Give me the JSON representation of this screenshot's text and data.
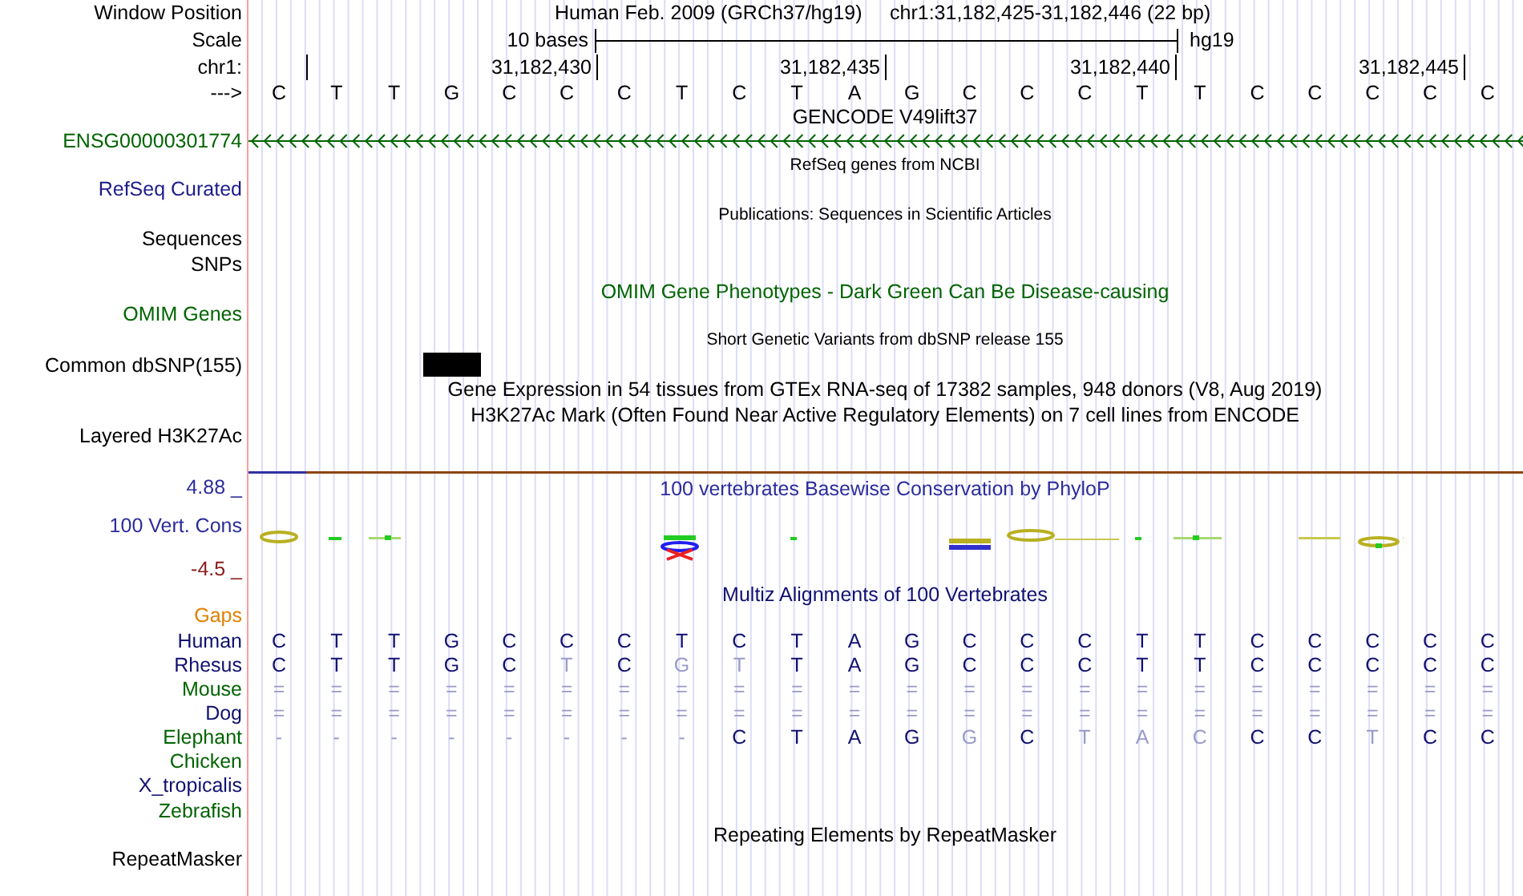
{
  "labels": [
    {
      "text": "Window Position",
      "color": "#000000"
    },
    {
      "text": "Scale",
      "color": "#000000"
    },
    {
      "text": "chr1:",
      "color": "#000000"
    },
    {
      "text": "--->",
      "color": "#000000"
    },
    {
      "text": "ENSG00000301774",
      "color": "#006400"
    },
    {
      "text": "RefSeq Curated",
      "color": "#1c1c8c"
    },
    {
      "text": "Sequences",
      "color": "#000000"
    },
    {
      "text": "SNPs",
      "color": "#000000"
    },
    {
      "text": "OMIM Genes",
      "color": "#006400"
    },
    {
      "text": "Common dbSNP(155)",
      "color": "#000000"
    },
    {
      "text": "Layered H3K27Ac",
      "color": "#000000"
    },
    {
      "text": "4.88 _",
      "color": "#2c2c9c"
    },
    {
      "text": "100 Vert. Cons",
      "color": "#2c2c9c"
    },
    {
      "text": "-4.5 _",
      "color": "#8b1a1a"
    },
    {
      "text": "Gaps",
      "color": "#e08000"
    },
    {
      "text": "Human",
      "color": "#101070"
    },
    {
      "text": "Rhesus",
      "color": "#101070"
    },
    {
      "text": "Mouse",
      "color": "#006400"
    },
    {
      "text": "Dog",
      "color": "#101070"
    },
    {
      "text": "Elephant",
      "color": "#006400"
    },
    {
      "text": "Chicken",
      "color": "#006400"
    },
    {
      "text": "X_tropicalis",
      "color": "#101070"
    },
    {
      "text": "Zebrafish",
      "color": "#006400"
    },
    {
      "text": "RepeatMasker",
      "color": "#000000"
    }
  ],
  "position": {
    "assembly": "Human Feb. 2009 (GRCh37/hg19)",
    "range": "chr1:31,182,425-31,182,446 (22 bp)"
  },
  "scale": {
    "length": "10 bases",
    "db": "hg19"
  },
  "ruler_ticks": [
    "31,182,430",
    "31,182,435",
    "31,182,440",
    "31,182,445"
  ],
  "sequence": [
    "C",
    "T",
    "T",
    "G",
    "C",
    "C",
    "C",
    "T",
    "C",
    "T",
    "A",
    "G",
    "C",
    "C",
    "C",
    "T",
    "T",
    "C",
    "C",
    "C",
    "C",
    "C"
  ],
  "tracks": [
    {
      "text": "GENCODE V49lift37",
      "kind": "normal",
      "color": "#000000"
    },
    {
      "text": "RefSeq genes from NCBI",
      "kind": "small",
      "color": "#000000"
    },
    {
      "text": "Publications: Sequences in Scientific Articles",
      "kind": "small",
      "color": "#000000"
    },
    {
      "text": "OMIM Gene Phenotypes - Dark Green Can Be Disease-causing",
      "kind": "normal",
      "color": "#006400"
    },
    {
      "text": "Short Genetic Variants from dbSNP release 155",
      "kind": "small",
      "color": "#000000"
    },
    {
      "text": "Gene Expression in 54 tissues from GTEx RNA-seq of 17382 samples, 948 donors (V8, Aug 2019)",
      "kind": "normal",
      "color": "#000000"
    },
    {
      "text": "H3K27Ac Mark (Often Found Near Active Regulatory Elements) on 7 cell lines from ENCODE",
      "kind": "normal",
      "color": "#000000"
    },
    {
      "text": "100 vertebrates Basewise Conservation by PhyloP",
      "kind": "normal",
      "color": "#2c2c9c"
    },
    {
      "text": "Multiz Alignments of 100 Vertebrates",
      "kind": "normal",
      "color": "#101070"
    },
    {
      "text": "Repeating Elements by RepeatMasker",
      "kind": "normal",
      "color": "#000000"
    }
  ],
  "alignment": [
    {
      "bases": [
        {
          "b": "C",
          "faded": false
        },
        {
          "b": "T",
          "faded": false
        },
        {
          "b": "T",
          "faded": false
        },
        {
          "b": "G",
          "faded": false
        },
        {
          "b": "C",
          "faded": false
        },
        {
          "b": "C",
          "faded": false
        },
        {
          "b": "C",
          "faded": false
        },
        {
          "b": "T",
          "faded": false
        },
        {
          "b": "C",
          "faded": false
        },
        {
          "b": "T",
          "faded": false
        },
        {
          "b": "A",
          "faded": false
        },
        {
          "b": "G",
          "faded": false
        },
        {
          "b": "C",
          "faded": false
        },
        {
          "b": "C",
          "faded": false
        },
        {
          "b": "C",
          "faded": false
        },
        {
          "b": "T",
          "faded": false
        },
        {
          "b": "T",
          "faded": false
        },
        {
          "b": "C",
          "faded": false
        },
        {
          "b": "C",
          "faded": false
        },
        {
          "b": "C",
          "faded": false
        },
        {
          "b": "C",
          "faded": false
        },
        {
          "b": "C",
          "faded": false
        }
      ]
    },
    {
      "bases": [
        {
          "b": "C",
          "faded": false
        },
        {
          "b": "T",
          "faded": false
        },
        {
          "b": "T",
          "faded": false
        },
        {
          "b": "G",
          "faded": false
        },
        {
          "b": "C",
          "faded": false
        },
        {
          "b": "T",
          "faded": true
        },
        {
          "b": "C",
          "faded": false
        },
        {
          "b": "G",
          "faded": true
        },
        {
          "b": "T",
          "faded": true
        },
        {
          "b": "T",
          "faded": false
        },
        {
          "b": "A",
          "faded": false
        },
        {
          "b": "G",
          "faded": false
        },
        {
          "b": "C",
          "faded": false
        },
        {
          "b": "C",
          "faded": false
        },
        {
          "b": "C",
          "faded": false
        },
        {
          "b": "T",
          "faded": false
        },
        {
          "b": "T",
          "faded": false
        },
        {
          "b": "C",
          "faded": false
        },
        {
          "b": "C",
          "faded": false
        },
        {
          "b": "C",
          "faded": false
        },
        {
          "b": "C",
          "faded": false
        },
        {
          "b": "C",
          "faded": false
        }
      ]
    },
    {
      "bases": [
        {
          "b": "=",
          "faded": true
        },
        {
          "b": "=",
          "faded": true
        },
        {
          "b": "=",
          "faded": true
        },
        {
          "b": "=",
          "faded": true
        },
        {
          "b": "=",
          "faded": true
        },
        {
          "b": "=",
          "faded": true
        },
        {
          "b": "=",
          "faded": true
        },
        {
          "b": "=",
          "faded": true
        },
        {
          "b": "=",
          "faded": true
        },
        {
          "b": "=",
          "faded": true
        },
        {
          "b": "=",
          "faded": true
        },
        {
          "b": "=",
          "faded": true
        },
        {
          "b": "=",
          "faded": true
        },
        {
          "b": "=",
          "faded": true
        },
        {
          "b": "=",
          "faded": true
        },
        {
          "b": "=",
          "faded": true
        },
        {
          "b": "=",
          "faded": true
        },
        {
          "b": "=",
          "faded": true
        },
        {
          "b": "=",
          "faded": true
        },
        {
          "b": "=",
          "faded": true
        },
        {
          "b": "=",
          "faded": true
        },
        {
          "b": "=",
          "faded": true
        }
      ]
    },
    {
      "bases": [
        {
          "b": "=",
          "faded": true
        },
        {
          "b": "=",
          "faded": true
        },
        {
          "b": "=",
          "faded": true
        },
        {
          "b": "=",
          "faded": true
        },
        {
          "b": "=",
          "faded": true
        },
        {
          "b": "=",
          "faded": true
        },
        {
          "b": "=",
          "faded": true
        },
        {
          "b": "=",
          "faded": true
        },
        {
          "b": "=",
          "faded": true
        },
        {
          "b": "=",
          "faded": true
        },
        {
          "b": "=",
          "faded": true
        },
        {
          "b": "=",
          "faded": true
        },
        {
          "b": "=",
          "faded": true
        },
        {
          "b": "=",
          "faded": true
        },
        {
          "b": "=",
          "faded": true
        },
        {
          "b": "=",
          "faded": true
        },
        {
          "b": "=",
          "faded": true
        },
        {
          "b": "=",
          "faded": true
        },
        {
          "b": "=",
          "faded": true
        },
        {
          "b": "=",
          "faded": true
        },
        {
          "b": "=",
          "faded": true
        },
        {
          "b": "=",
          "faded": true
        }
      ]
    },
    {
      "bases": [
        {
          "b": "-",
          "faded": true
        },
        {
          "b": "-",
          "faded": true
        },
        {
          "b": "-",
          "faded": true
        },
        {
          "b": "-",
          "faded": true
        },
        {
          "b": "-",
          "faded": true
        },
        {
          "b": "-",
          "faded": true
        },
        {
          "b": "-",
          "faded": true
        },
        {
          "b": "-",
          "faded": true
        },
        {
          "b": "C",
          "faded": false
        },
        {
          "b": "T",
          "faded": false
        },
        {
          "b": "A",
          "faded": false
        },
        {
          "b": "G",
          "faded": false
        },
        {
          "b": "G",
          "faded": true
        },
        {
          "b": "C",
          "faded": false
        },
        {
          "b": "T",
          "faded": true
        },
        {
          "b": "A",
          "faded": true
        },
        {
          "b": "C",
          "faded": true
        },
        {
          "b": "C",
          "faded": false
        },
        {
          "b": "C",
          "faded": false
        },
        {
          "b": "T",
          "faded": true
        },
        {
          "b": "C",
          "faded": false
        },
        {
          "b": "C",
          "faded": false
        }
      ]
    }
  ]
}
